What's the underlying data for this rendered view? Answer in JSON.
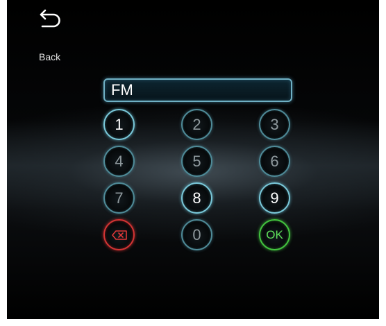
{
  "back": {
    "label": "Back",
    "icon": "back-arrow-icon"
  },
  "display": {
    "value": "FM"
  },
  "keypad": {
    "keys": [
      {
        "label": "1",
        "state": "active"
      },
      {
        "label": "2",
        "state": "disabled"
      },
      {
        "label": "3",
        "state": "disabled"
      },
      {
        "label": "4",
        "state": "disabled"
      },
      {
        "label": "5",
        "state": "disabled"
      },
      {
        "label": "6",
        "state": "disabled"
      },
      {
        "label": "7",
        "state": "disabled"
      },
      {
        "label": "8",
        "state": "active"
      },
      {
        "label": "9",
        "state": "active"
      },
      {
        "label": "0",
        "state": "disabled"
      }
    ],
    "delete_icon": "backspace-icon",
    "ok_label": "OK"
  },
  "colors": {
    "key_ring": "#79c7d8",
    "delete_ring": "#d23434",
    "ok_ring": "#43c43f",
    "ok_text": "#5fe05a",
    "disabled_text": "#8f999d"
  }
}
